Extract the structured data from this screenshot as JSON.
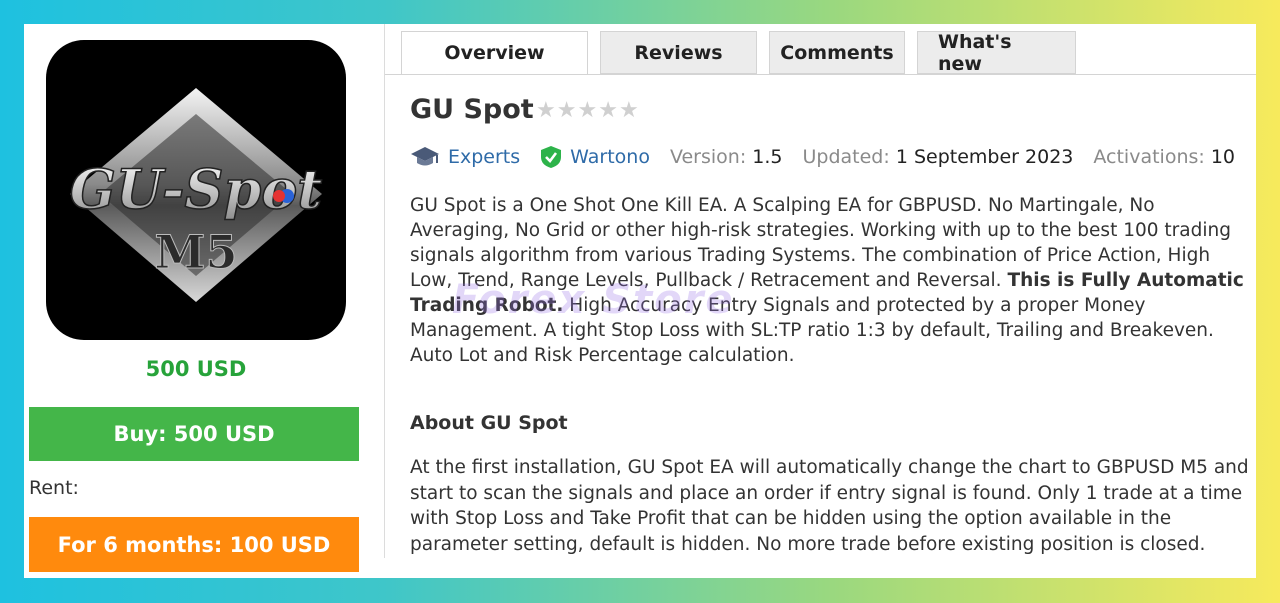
{
  "product": {
    "image_alt_line1": "GU-Spot",
    "image_alt_line2": "M5",
    "price": "500 USD",
    "buy_label": "Buy: 500 USD",
    "rent_label": "Rent:",
    "rent_button": "For 6 months: 100 USD"
  },
  "tabs": [
    {
      "label": "Overview",
      "active": true
    },
    {
      "label": "Reviews"
    },
    {
      "label": "Comments"
    },
    {
      "label": "What's new"
    }
  ],
  "title": "GU Spot",
  "rating": {
    "stars": 0,
    "max": 5
  },
  "meta": {
    "category": "Experts",
    "author": "Wartono",
    "version_label": "Version:",
    "version": "1.5",
    "updated_label": "Updated:",
    "updated": "1 September 2023",
    "activations_label": "Activations:",
    "activations": "10"
  },
  "description": {
    "part1": "GU Spot is a One Shot One Kill EA. A Scalping EA for GBPUSD. No Martingale, No Averaging, No Grid or other high-risk strategies. Working with up to the best 100 trading signals algorithm from various Trading Systems. The combination of Price Action, High Low, Trend, Range Levels, Pullback / Retracement and Reversal. ",
    "bold": "This is Fully Automatic Trading Robot.",
    "part2": " High Accuracy Entry Signals and protected by a proper Money Management. A tight Stop Loss with SL:TP ratio 1:3 by default, Trailing and Breakeven. Auto Lot and Risk Percentage calculation."
  },
  "about": {
    "title": "About GU Spot",
    "text": "At the first installation, GU Spot EA will automatically change the chart to GBPUSD M5 and start to scan the signals and place an order if entry signal is found. Only 1 trade at a time with Stop Loss and Take Profit that can be hidden using the option available in the parameter setting, default is hidden. No more trade before existing position is closed."
  },
  "watermark": "Forex Store",
  "colors": {
    "price_green": "#27a33a",
    "buy_green": "#44b649",
    "rent_orange": "#ff8a0d",
    "link_blue": "#2f6ba8"
  },
  "icons": [
    "graduation-cap-icon",
    "verified-shield-icon",
    "star-icon"
  ]
}
